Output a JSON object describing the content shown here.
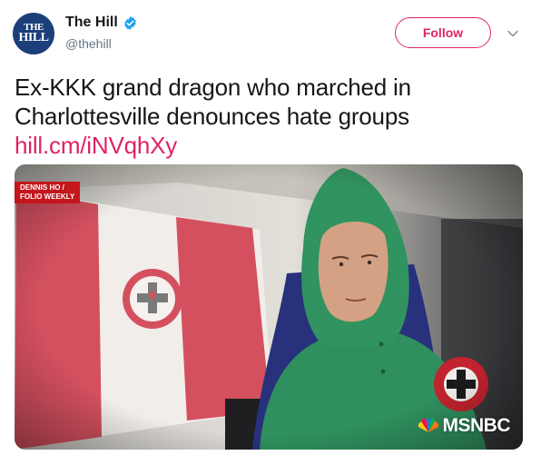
{
  "account": {
    "avatar_line1": "THE",
    "avatar_line2": "HILL",
    "display_name": "The Hill",
    "handle": "@thehill",
    "verified": true
  },
  "header": {
    "follow_label": "Follow",
    "menu_icon": "chevron-down-icon"
  },
  "tweet": {
    "text": "Ex-KKK grand dragon who marched in Charlottesville denounces hate groups ",
    "link_text": "hill.cm/iNVqhXy"
  },
  "media": {
    "credit_line1": "DENNIS HO /",
    "credit_line2": "FOLIO WEEKLY",
    "network_logo": "MSNBC"
  },
  "colors": {
    "accent": "#e0245e",
    "verified": "#1da1f2",
    "text": "#14171a",
    "muted": "#657786",
    "credit_bg": "#c4161c"
  }
}
